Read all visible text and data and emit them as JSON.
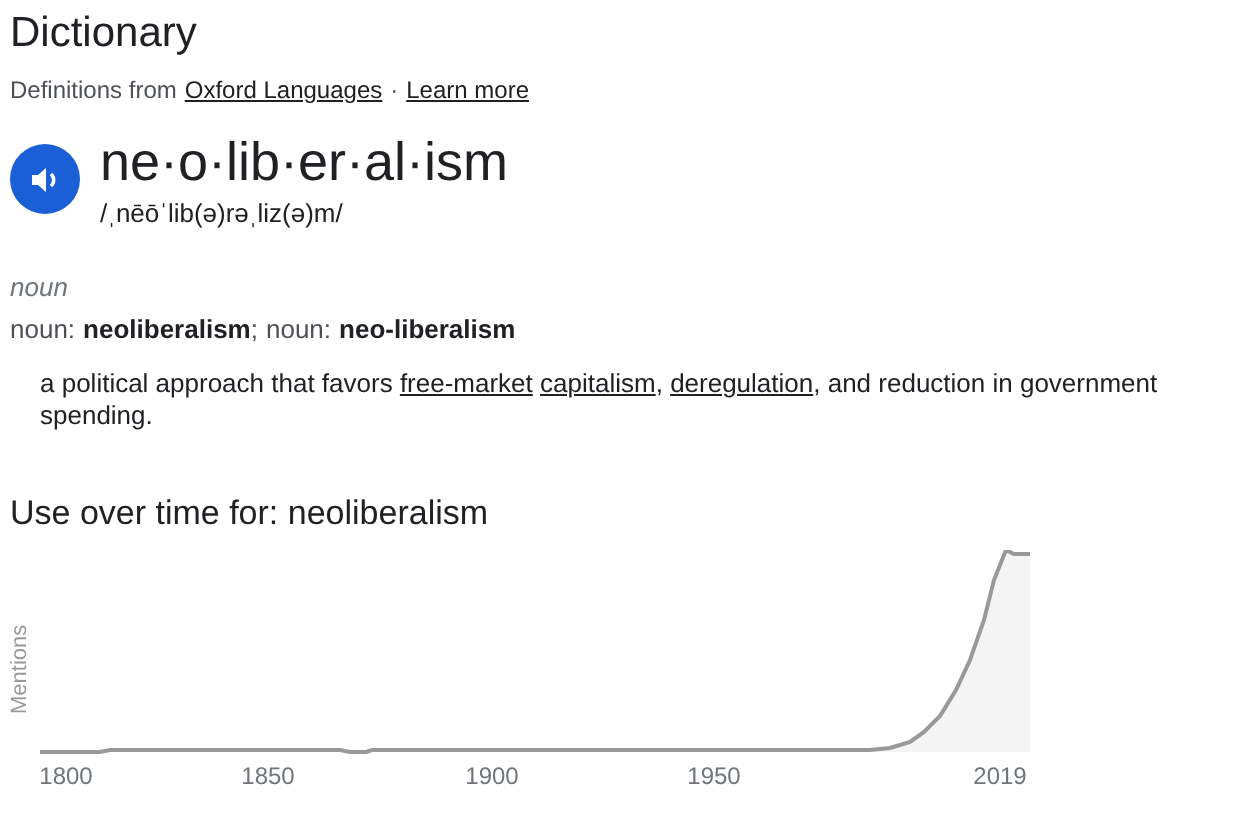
{
  "title": "Dictionary",
  "source": {
    "prefix": "Definitions from",
    "link": "Oxford Languages",
    "separator": "·",
    "learn_more": "Learn more"
  },
  "entry": {
    "headword": "ne·o·lib·er·al·ism",
    "pronunciation": "/ˌnēōˈlib(ə)rəˌliz(ə)m/",
    "part_of_speech": "noun",
    "forms": [
      {
        "label": "noun:",
        "word": "neoliberalism",
        "separator": ";"
      },
      {
        "label": "noun:",
        "word": "neo-liberalism"
      }
    ],
    "definition": [
      {
        "text": "a political approach that favors ",
        "link": false
      },
      {
        "text": "free-market",
        "link": true
      },
      {
        "text": "capitalism",
        "link": true
      },
      {
        "text": ", ",
        "link": false
      },
      {
        "text": "deregulation",
        "link": true
      },
      {
        "text": ", and reduction in government spending.",
        "link": false
      }
    ]
  },
  "usage": {
    "title": "Use over time for: neoliberalism",
    "y_label": "Mentions",
    "x_labels": [
      "1800",
      "1850",
      "1900",
      "1950",
      "2019"
    ]
  }
}
